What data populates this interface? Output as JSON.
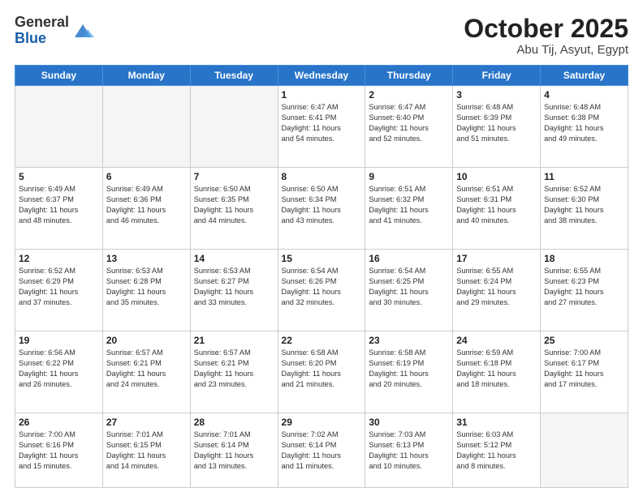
{
  "logo": {
    "general": "General",
    "blue": "Blue"
  },
  "title": {
    "month": "October 2025",
    "location": "Abu Tij, Asyut, Egypt"
  },
  "weekdays": [
    "Sunday",
    "Monday",
    "Tuesday",
    "Wednesday",
    "Thursday",
    "Friday",
    "Saturday"
  ],
  "weeks": [
    [
      {
        "day": "",
        "info": ""
      },
      {
        "day": "",
        "info": ""
      },
      {
        "day": "",
        "info": ""
      },
      {
        "day": "1",
        "info": "Sunrise: 6:47 AM\nSunset: 6:41 PM\nDaylight: 11 hours\nand 54 minutes."
      },
      {
        "day": "2",
        "info": "Sunrise: 6:47 AM\nSunset: 6:40 PM\nDaylight: 11 hours\nand 52 minutes."
      },
      {
        "day": "3",
        "info": "Sunrise: 6:48 AM\nSunset: 6:39 PM\nDaylight: 11 hours\nand 51 minutes."
      },
      {
        "day": "4",
        "info": "Sunrise: 6:48 AM\nSunset: 6:38 PM\nDaylight: 11 hours\nand 49 minutes."
      }
    ],
    [
      {
        "day": "5",
        "info": "Sunrise: 6:49 AM\nSunset: 6:37 PM\nDaylight: 11 hours\nand 48 minutes."
      },
      {
        "day": "6",
        "info": "Sunrise: 6:49 AM\nSunset: 6:36 PM\nDaylight: 11 hours\nand 46 minutes."
      },
      {
        "day": "7",
        "info": "Sunrise: 6:50 AM\nSunset: 6:35 PM\nDaylight: 11 hours\nand 44 minutes."
      },
      {
        "day": "8",
        "info": "Sunrise: 6:50 AM\nSunset: 6:34 PM\nDaylight: 11 hours\nand 43 minutes."
      },
      {
        "day": "9",
        "info": "Sunrise: 6:51 AM\nSunset: 6:32 PM\nDaylight: 11 hours\nand 41 minutes."
      },
      {
        "day": "10",
        "info": "Sunrise: 6:51 AM\nSunset: 6:31 PM\nDaylight: 11 hours\nand 40 minutes."
      },
      {
        "day": "11",
        "info": "Sunrise: 6:52 AM\nSunset: 6:30 PM\nDaylight: 11 hours\nand 38 minutes."
      }
    ],
    [
      {
        "day": "12",
        "info": "Sunrise: 6:52 AM\nSunset: 6:29 PM\nDaylight: 11 hours\nand 37 minutes."
      },
      {
        "day": "13",
        "info": "Sunrise: 6:53 AM\nSunset: 6:28 PM\nDaylight: 11 hours\nand 35 minutes."
      },
      {
        "day": "14",
        "info": "Sunrise: 6:53 AM\nSunset: 6:27 PM\nDaylight: 11 hours\nand 33 minutes."
      },
      {
        "day": "15",
        "info": "Sunrise: 6:54 AM\nSunset: 6:26 PM\nDaylight: 11 hours\nand 32 minutes."
      },
      {
        "day": "16",
        "info": "Sunrise: 6:54 AM\nSunset: 6:25 PM\nDaylight: 11 hours\nand 30 minutes."
      },
      {
        "day": "17",
        "info": "Sunrise: 6:55 AM\nSunset: 6:24 PM\nDaylight: 11 hours\nand 29 minutes."
      },
      {
        "day": "18",
        "info": "Sunrise: 6:55 AM\nSunset: 6:23 PM\nDaylight: 11 hours\nand 27 minutes."
      }
    ],
    [
      {
        "day": "19",
        "info": "Sunrise: 6:56 AM\nSunset: 6:22 PM\nDaylight: 11 hours\nand 26 minutes."
      },
      {
        "day": "20",
        "info": "Sunrise: 6:57 AM\nSunset: 6:21 PM\nDaylight: 11 hours\nand 24 minutes."
      },
      {
        "day": "21",
        "info": "Sunrise: 6:57 AM\nSunset: 6:21 PM\nDaylight: 11 hours\nand 23 minutes."
      },
      {
        "day": "22",
        "info": "Sunrise: 6:58 AM\nSunset: 6:20 PM\nDaylight: 11 hours\nand 21 minutes."
      },
      {
        "day": "23",
        "info": "Sunrise: 6:58 AM\nSunset: 6:19 PM\nDaylight: 11 hours\nand 20 minutes."
      },
      {
        "day": "24",
        "info": "Sunrise: 6:59 AM\nSunset: 6:18 PM\nDaylight: 11 hours\nand 18 minutes."
      },
      {
        "day": "25",
        "info": "Sunrise: 7:00 AM\nSunset: 6:17 PM\nDaylight: 11 hours\nand 17 minutes."
      }
    ],
    [
      {
        "day": "26",
        "info": "Sunrise: 7:00 AM\nSunset: 6:16 PM\nDaylight: 11 hours\nand 15 minutes."
      },
      {
        "day": "27",
        "info": "Sunrise: 7:01 AM\nSunset: 6:15 PM\nDaylight: 11 hours\nand 14 minutes."
      },
      {
        "day": "28",
        "info": "Sunrise: 7:01 AM\nSunset: 6:14 PM\nDaylight: 11 hours\nand 13 minutes."
      },
      {
        "day": "29",
        "info": "Sunrise: 7:02 AM\nSunset: 6:14 PM\nDaylight: 11 hours\nand 11 minutes."
      },
      {
        "day": "30",
        "info": "Sunrise: 7:03 AM\nSunset: 6:13 PM\nDaylight: 11 hours\nand 10 minutes."
      },
      {
        "day": "31",
        "info": "Sunrise: 6:03 AM\nSunset: 5:12 PM\nDaylight: 11 hours\nand 8 minutes."
      },
      {
        "day": "",
        "info": ""
      }
    ]
  ]
}
